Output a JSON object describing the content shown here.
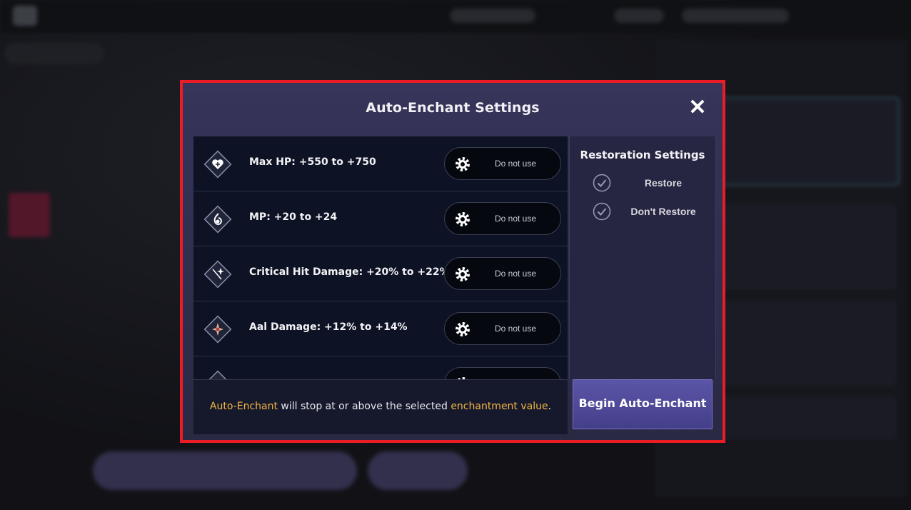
{
  "modal": {
    "title": "Auto-Enchant Settings",
    "close_icon": "close-icon",
    "border_color": "#ec1c24"
  },
  "options": [
    {
      "label": "Max HP: +550 to +750",
      "icon": "heart-icon",
      "setting": "Do not use"
    },
    {
      "label": "MP: +20 to +24",
      "icon": "mp-drop-icon",
      "setting": "Do not use"
    },
    {
      "label": "Critical Hit Damage: +20% to +22%",
      "icon": "critical-spark-icon",
      "setting": "Do not use"
    },
    {
      "label": "Aal Damage: +12% to +14%",
      "icon": "aal-burst-icon",
      "setting": "Do not use"
    },
    {
      "label": "",
      "icon": "stat-icon",
      "setting": ""
    }
  ],
  "restoration": {
    "title": "Restoration Settings",
    "choices": [
      {
        "label": "Restore",
        "icon": "check-circle-icon"
      },
      {
        "label": "Don't Restore",
        "icon": "check-circle-icon"
      }
    ]
  },
  "note": {
    "part1": "Auto-Enchant",
    "part2": " will stop at or above the selected ",
    "part3": "enchantment value",
    "part4": "."
  },
  "begin_button": {
    "label": "Begin Auto-Enchant"
  },
  "colors": {
    "accent": "#f2b544",
    "button": "#4f4999"
  }
}
